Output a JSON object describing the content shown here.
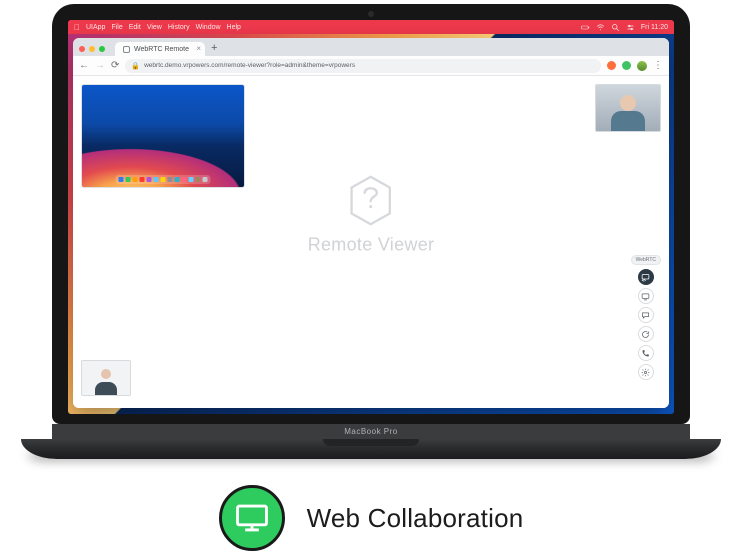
{
  "laptop_model": "MacBook Pro",
  "menubar": {
    "app": "UIApp",
    "items": [
      "File",
      "Edit",
      "View",
      "History",
      "Window",
      "Help"
    ],
    "clock": "Fri 11:20"
  },
  "browser": {
    "tab_title": "WebRTC Remote",
    "url": "webrtc.demo.vrpowers.com/remote-viewer?role=admin&theme=vrpowers"
  },
  "page": {
    "app_name": "Remote Viewer",
    "share_label": "Screen share",
    "webcam_a": "Remote participant",
    "webcam_b": "Local camera",
    "pill": "WebRTC",
    "tools": [
      {
        "name": "cast-button",
        "icon": "cast"
      },
      {
        "name": "screen-button",
        "icon": "screen"
      },
      {
        "name": "chat-button",
        "icon": "chat"
      },
      {
        "name": "refresh-button",
        "icon": "refresh"
      },
      {
        "name": "hangup-button",
        "icon": "phone"
      },
      {
        "name": "settings-button",
        "icon": "gear"
      }
    ]
  },
  "caption": {
    "label": "Web Collaboration"
  },
  "dock_colors": [
    "#3478f6",
    "#34c759",
    "#ff9f0a",
    "#ff3b30",
    "#af52de",
    "#5ac8fa",
    "#ffd60a",
    "#8e8e93",
    "#30b0c7",
    "#ff6482",
    "#64d2ff",
    "#a2845e",
    "#c7c7cc"
  ]
}
